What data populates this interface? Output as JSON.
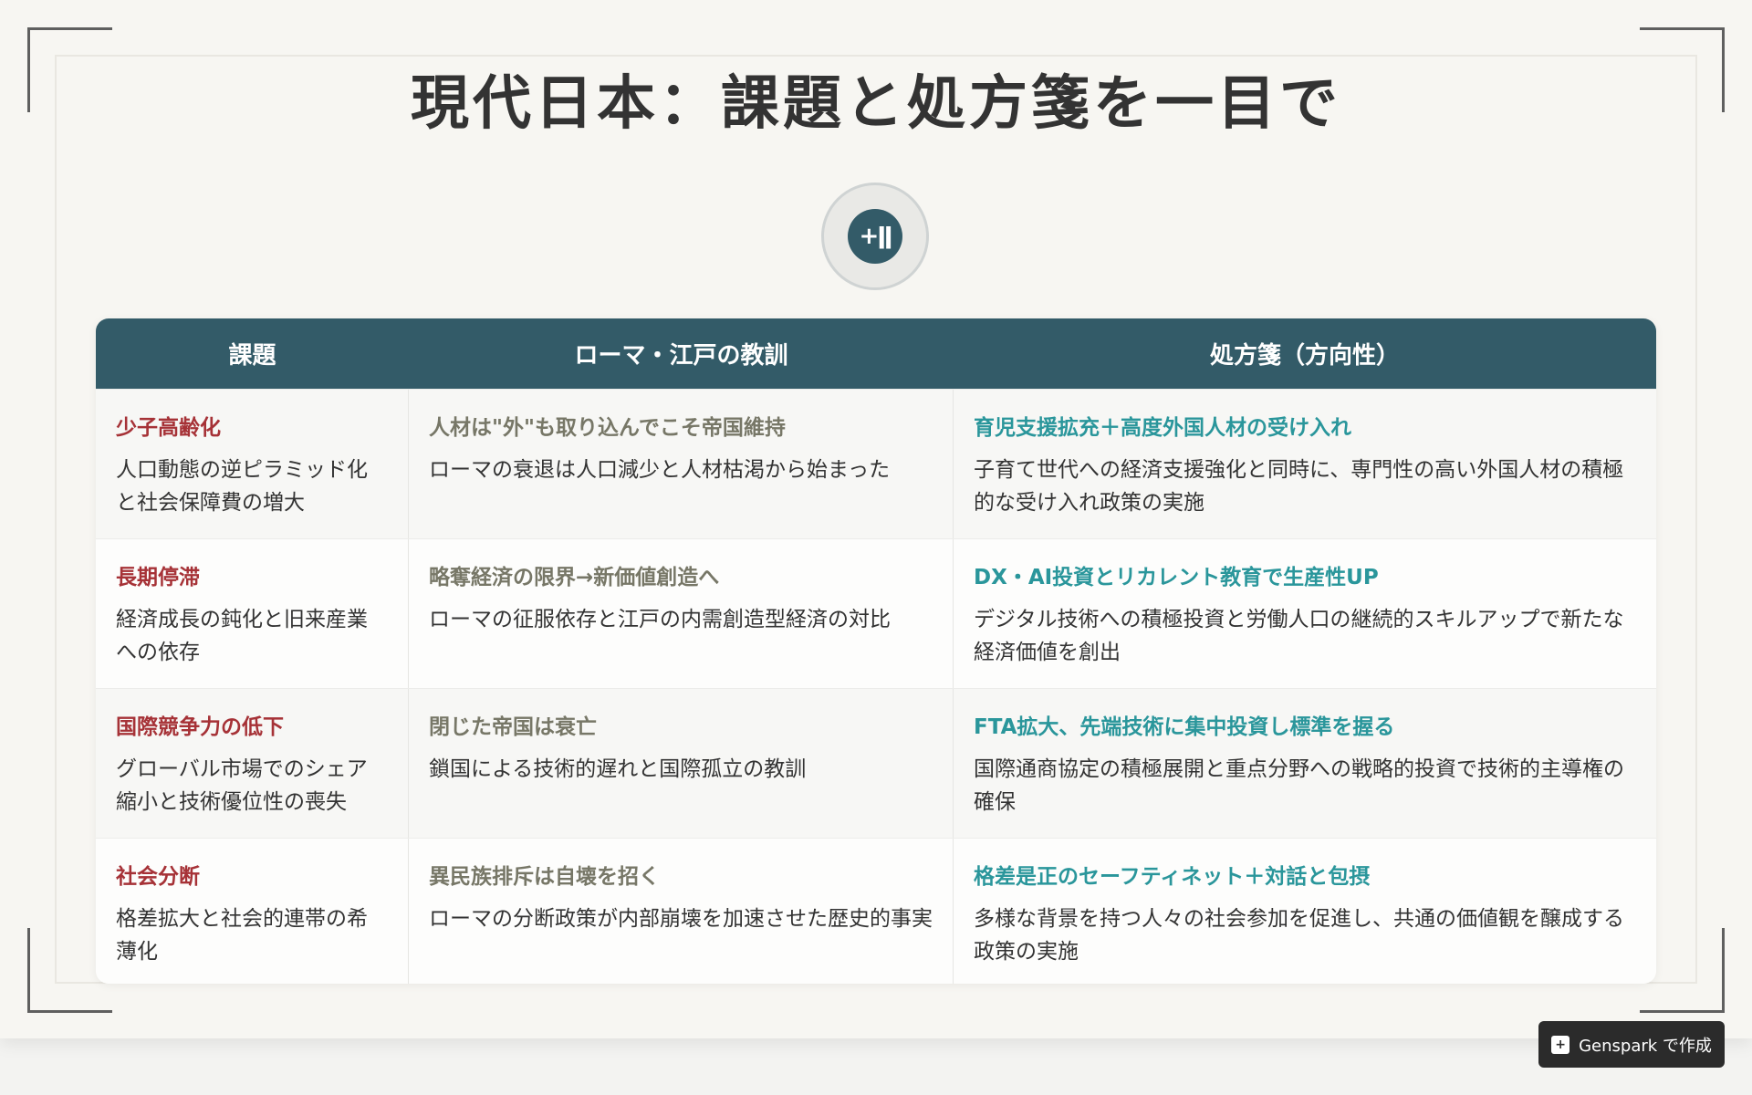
{
  "title": "現代日本：課題と処方箋を一目で",
  "badge_icon": "plus-pause-icon",
  "table": {
    "headers": [
      "課題",
      "ローマ・江戸の教訓",
      "処方箋（方向性）"
    ],
    "rows": [
      {
        "issue_title": "少子高齢化",
        "issue_desc": "人口動態の逆ピラミッド化と社会保障費の増大",
        "lesson_title": "人材は\"外\"も取り込んでこそ帝国維持",
        "lesson_desc": "ローマの衰退は人口減少と人材枯渇から始まった",
        "rx_title": "育児支援拡充＋高度外国人材の受け入れ",
        "rx_desc": "子育て世代への経済支援強化と同時に、専門性の高い外国人材の積極的な受け入れ政策の実施"
      },
      {
        "issue_title": "長期停滞",
        "issue_desc": "経済成長の鈍化と旧来産業への依存",
        "lesson_title": "略奪経済の限界→新価値創造へ",
        "lesson_desc": "ローマの征服依存と江戸の内需創造型経済の対比",
        "rx_title": "DX・AI投資とリカレント教育で生産性UP",
        "rx_desc": "デジタル技術への積極投資と労働人口の継続的スキルアップで新たな経済価値を創出"
      },
      {
        "issue_title": "国際競争力の低下",
        "issue_desc": "グローバル市場でのシェア縮小と技術優位性の喪失",
        "lesson_title": "閉じた帝国は衰亡",
        "lesson_desc": "鎖国による技術的遅れと国際孤立の教訓",
        "rx_title": "FTA拡大、先端技術に集中投資し標準を握る",
        "rx_desc": "国際通商協定の積極展開と重点分野への戦略的投資で技術的主導権の確保"
      },
      {
        "issue_title": "社会分断",
        "issue_desc": "格差拡大と社会的連帯の希薄化",
        "lesson_title": "異民族排斥は自壊を招く",
        "lesson_desc": "ローマの分断政策が内部崩壊を加速させた歴史的事実",
        "rx_title": "格差是正のセーフティネット＋対話と包摂",
        "rx_desc": "多様な背景を持つ人々の社会参加を促進し、共通の価値観を醸成する政策の実施"
      }
    ]
  },
  "footer_button": {
    "icon": "genspark-logo-icon",
    "label": "Genspark で作成"
  },
  "colors": {
    "header_bg": "#335b68",
    "issue_title": "#a63237",
    "lesson_title": "#777767",
    "rx_title": "#2a969b"
  }
}
